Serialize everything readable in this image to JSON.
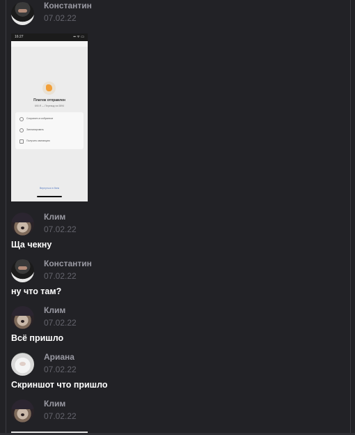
{
  "messages": [
    {
      "author": "Константин",
      "date": "07.02.22",
      "avatar": "balaclava-avatar",
      "attachment": {
        "status_time": "16:27",
        "status_icons": "▪▪ ᯤ ▭",
        "title": "Платеж отправлен",
        "subtitle": "690 ₽ — Перевод на 0894",
        "rows": [
          "Сохранить в избранное",
          "Запланировать",
          "Получить квитанцию"
        ],
        "link": "Вернуться в банк"
      }
    },
    {
      "author": "Клим",
      "date": "07.02.22",
      "avatar": "dog-avatar",
      "text": "Ща чекну"
    },
    {
      "author": "Константин",
      "date": "07.02.22",
      "avatar": "balaclava-avatar",
      "text": "ну что там?"
    },
    {
      "author": "Клим",
      "date": "07.02.22",
      "avatar": "dog-avatar",
      "text": "Всё пришло"
    },
    {
      "author": "Ариана",
      "date": "07.02.22",
      "avatar": "bunny-avatar",
      "text": "Скриншот что пришло"
    },
    {
      "author": "Клим",
      "date": "07.02.22",
      "avatar": "dog-avatar"
    }
  ]
}
